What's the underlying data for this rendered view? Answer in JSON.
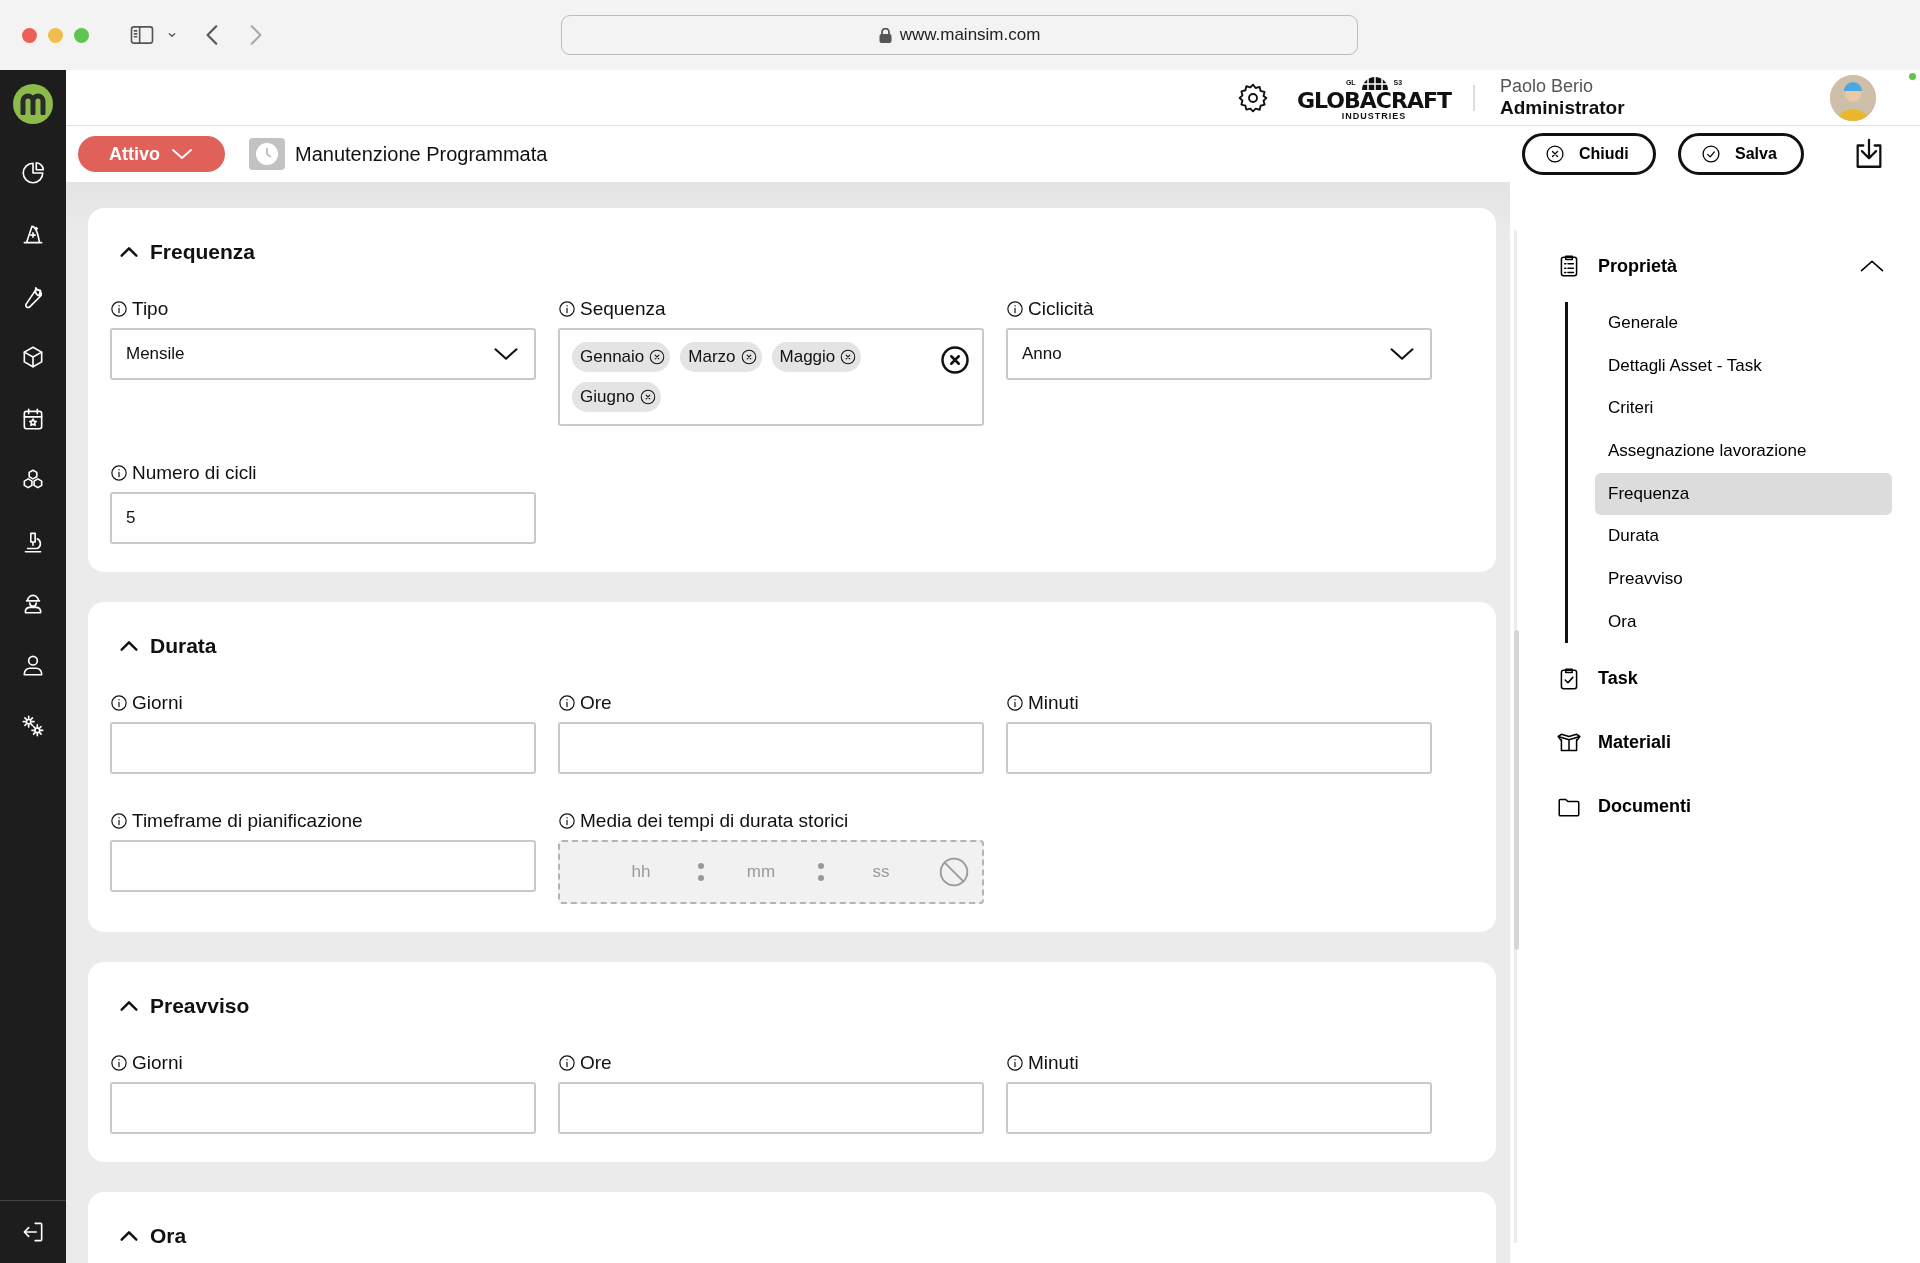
{
  "browser": {
    "url": "www.mainsim.com"
  },
  "header": {
    "logo": {
      "top_left": "GL",
      "top_right": "S3",
      "name": "GLOBACRAFT",
      "tagline": "INDUSTRIES"
    },
    "user": {
      "name": "Paolo Berio",
      "role": "Administrator"
    }
  },
  "toolbar": {
    "status": "Attivo",
    "title": "Manutenzione Programmata",
    "buttons": [
      {
        "label": "Chiudi",
        "kind": "close"
      },
      {
        "label": "Salva",
        "kind": "save"
      }
    ]
  },
  "sections": [
    {
      "title": "Frequenza",
      "expanded": true,
      "fields": [
        {
          "label": "Tipo",
          "kind": "select",
          "value": "Mensile"
        },
        {
          "label": "Sequenza",
          "kind": "tags",
          "tags": [
            "Gennaio",
            "Marzo",
            "Maggio",
            "Giugno"
          ]
        },
        {
          "label": "Ciclicità",
          "kind": "select",
          "value": "Anno"
        },
        {
          "label": "Numero di cicli",
          "kind": "text",
          "value": "5"
        }
      ]
    },
    {
      "title": "Durata",
      "expanded": true,
      "fields": [
        {
          "label": "Giorni",
          "kind": "text"
        },
        {
          "label": "Ore",
          "kind": "text"
        },
        {
          "label": "Minuti",
          "kind": "text"
        },
        {
          "label": "Timeframe di pianificazione",
          "kind": "text"
        },
        {
          "label": "Media dei tempi di durata storici",
          "kind": "time",
          "disabled": true,
          "placeholders": [
            "hh",
            "mm",
            "ss"
          ]
        }
      ]
    },
    {
      "title": "Preavviso",
      "expanded": true,
      "fields": [
        {
          "label": "Giorni",
          "kind": "text"
        },
        {
          "label": "Ore",
          "kind": "text"
        },
        {
          "label": "Minuti",
          "kind": "text"
        }
      ]
    },
    {
      "title": "Ora",
      "expanded": true
    }
  ],
  "nav": {
    "groups": [
      {
        "label": "Proprietà",
        "expanded": true,
        "children": [
          {
            "label": "Generale",
            "selected": false
          },
          {
            "label": "Dettagli Asset - Task",
            "selected": false
          },
          {
            "label": "Criteri",
            "selected": false
          },
          {
            "label": "Assegnazione lavorazione",
            "selected": false
          },
          {
            "label": "Frequenza",
            "selected": true
          },
          {
            "label": "Durata",
            "selected": false
          },
          {
            "label": "Preavviso",
            "selected": false
          },
          {
            "label": "Ora",
            "selected": false
          }
        ]
      },
      {
        "label": "Task"
      },
      {
        "label": "Materiali"
      },
      {
        "label": "Documenti"
      }
    ]
  }
}
